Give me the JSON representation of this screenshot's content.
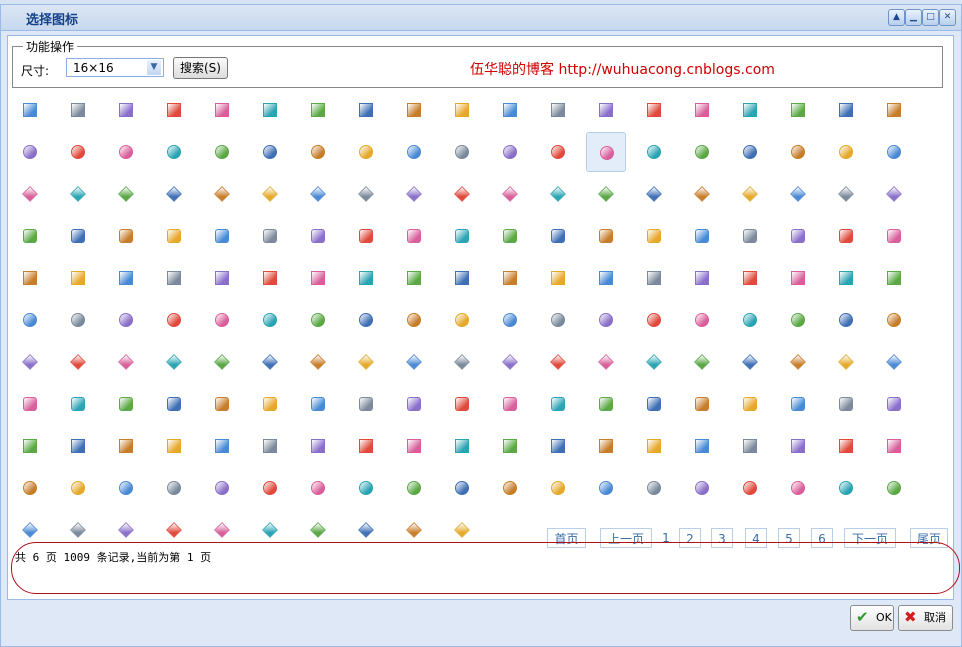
{
  "window": {
    "title": "选择图标"
  },
  "fieldset": {
    "legend": "功能操作",
    "size_label": "尺寸:",
    "size_value": "16×16",
    "search_label": "搜索(S)",
    "blog_text": "伍华聪的博客 http://wuhuacong.cnblogs.com"
  },
  "footer": {
    "summary": "共 6 页 1009 条记录,当前为第 1 页",
    "first": "首页",
    "prev": "上一页",
    "pages": [
      "1",
      "2",
      "3",
      "4",
      "5",
      "6"
    ],
    "next": "下一页",
    "last": "尾页"
  },
  "buttons": {
    "ok": "OK",
    "cancel": "取消"
  },
  "icon_grid": {
    "selected_index": 31,
    "rows": [
      [
        "page-add",
        "stop",
        "code",
        "arrows",
        "windows",
        "new-badge",
        "window-add",
        "csv",
        "disc",
        "truck",
        "folder-go",
        "pencil-tool",
        "layout",
        "comment",
        "h1",
        "window",
        "car",
        "calendar",
        "lightning"
      ],
      [
        "arrow-up-right",
        "page-gear",
        "arrow-up",
        "drive-go",
        "cart-add",
        "lock-go",
        "disc-small",
        "page-edit",
        "stamp",
        "dot",
        "cup",
        "page-blank",
        "zoom",
        "telephone",
        "key-group",
        "folder-open",
        "page-go",
        "shapes",
        "camera"
      ],
      [
        "printer",
        "user-comment",
        "window-blue",
        "chart-add",
        "funnel-add",
        "building",
        "layout-sidebar",
        "link-add",
        "ruby-go",
        "plugin",
        "gear",
        "star",
        "money",
        "keyboard",
        "window-blank",
        "monitor",
        "arrow-up-green",
        "user",
        "puzzle"
      ],
      [
        "comment-add",
        "window-add",
        "page-copy",
        "bold",
        "user-warn",
        "image-edit",
        "page-blank-2",
        "tag",
        "folder-warn",
        "table",
        "play",
        "image-add",
        "drive-go-2",
        "script",
        "arrow-turn",
        "disc-2",
        "window-2",
        "clock-add",
        "underline"
      ],
      [
        "tree-add",
        "pencil-color",
        "medal-red",
        "cd",
        "image-pencil",
        "dial",
        "plus",
        "ppt",
        "picture",
        "ruby",
        "gear-2",
        "user-orange",
        "folder-image",
        "camera-warn",
        "list",
        "palette",
        "page-layout",
        "card",
        "medal-gold"
      ],
      [
        "flask",
        "sigma",
        "arrows-refresh",
        "ball-grey",
        "h2",
        "house-warn",
        "ruby-red",
        "calendar-red",
        "excel",
        "folder-user",
        "go-green",
        "plus-green",
        "contrast",
        "user-dark",
        "tag-grey",
        "color-wheel",
        "drive-red",
        "user-grey",
        "users"
      ],
      [
        "dot-blue",
        "image-go",
        "window-split",
        "box",
        "hourglass",
        "script-edit",
        "rss-circle",
        "ring",
        "cd-2",
        "h5",
        "font",
        "refresh-green",
        "printer-2",
        "page-user",
        "heart",
        "record",
        "user-key",
        "code-2",
        "cross"
      ],
      [
        "cup-warn",
        "thumb",
        "email",
        "user-add",
        "page-warn",
        "computer-link",
        "check",
        "tag-edit",
        "page-script",
        "folder-add",
        "flag-bell",
        "folder-star",
        "flag-pink",
        "headset",
        "award",
        "dot-orange",
        "dot-yellow",
        "pencil-page",
        "drive-link"
      ],
      [
        "clock",
        "monitor-go",
        "alarm",
        "film-warn",
        "camera-go",
        "cd-go",
        "record-red",
        "sound",
        "film-play",
        "stamp-2",
        "flag-blue",
        "user-go",
        "cd-blue",
        "email-open",
        "rss",
        "page-edit-2",
        "tv",
        "computer",
        "email-2"
      ],
      [
        "media-prev",
        "folder-page",
        "coins",
        "clock-edit",
        "comment-2",
        "phone-lock",
        "pencil",
        "funnel-red",
        "image-edit-2",
        "rss-2",
        "wave",
        "chart-blank",
        "camera-2",
        "door",
        "arrows-green",
        "ball-dark",
        "folder-pencil",
        "page-pencil",
        "drive-2"
      ],
      [
        "cake",
        "arrows-shuffle",
        "media-next",
        "dollar",
        "windows-2",
        "image-small",
        "users-2",
        "window-go",
        "bin",
        "chart-bar"
      ]
    ]
  }
}
